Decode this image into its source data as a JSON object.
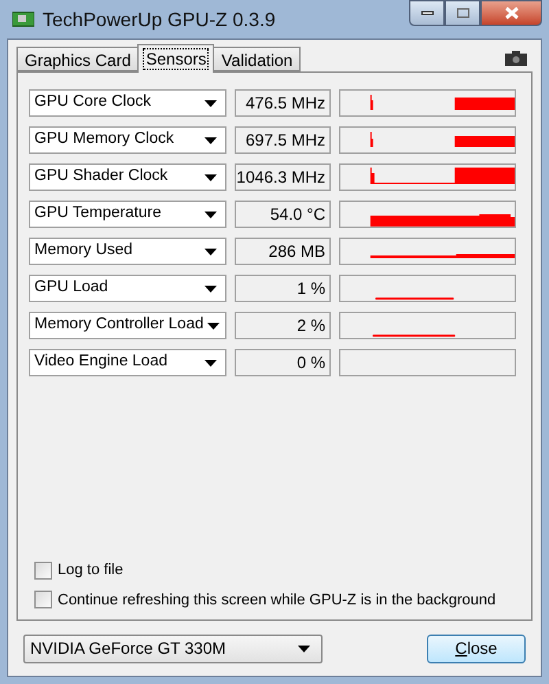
{
  "window": {
    "title": "TechPowerUp GPU-Z 0.3.9"
  },
  "tabs": [
    {
      "label": "Graphics Card",
      "selected": false
    },
    {
      "label": "Sensors",
      "selected": true
    },
    {
      "label": "Validation",
      "selected": false
    }
  ],
  "sensors": [
    {
      "name": "GPU Core Clock",
      "reading": "476.5 MHz"
    },
    {
      "name": "GPU Memory Clock",
      "reading": "697.5 MHz"
    },
    {
      "name": "GPU Shader Clock",
      "reading": "1046.3 MHz"
    },
    {
      "name": "GPU Temperature",
      "reading": "54.0 °C"
    },
    {
      "name": "Memory Used",
      "reading": "286 MB"
    },
    {
      "name": "GPU Load",
      "reading": "1 %"
    },
    {
      "name": "Memory Controller Load",
      "reading": "2 %"
    },
    {
      "name": "Video Engine Load",
      "reading": "0 %"
    }
  ],
  "options": [
    {
      "label": "Log to file",
      "checked": false
    },
    {
      "label": "Continue refreshing this screen while GPU-Z is in the background",
      "checked": false
    }
  ],
  "device": {
    "value": "NVIDIA GeForce GT 330M"
  },
  "buttons": [
    "Close"
  ]
}
